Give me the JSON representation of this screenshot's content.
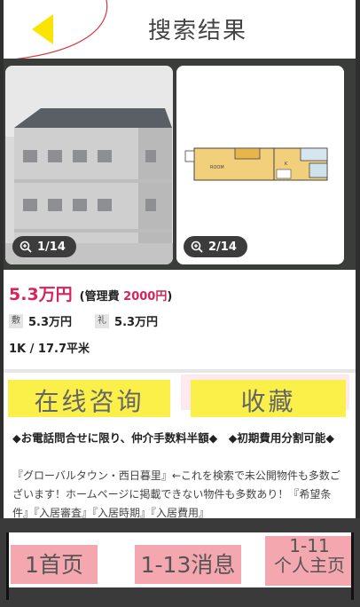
{
  "header": {
    "title": "搜索结果",
    "back_icon": "triangle-left-icon",
    "colors": {
      "back_icon": "#fbe400",
      "decoration": "#d9363e"
    }
  },
  "gallery": {
    "photos": [
      {
        "counter": "1/14",
        "icon": "zoom-in-icon",
        "kind": "building-exterior"
      },
      {
        "counter": "2/14",
        "icon": "zoom-in-icon",
        "kind": "floor-plan",
        "plan_labels": [
          "ROOM",
          "K"
        ]
      }
    ]
  },
  "listing": {
    "price": "5.3万円",
    "management_open": "(管理費",
    "management_fee": "2000円",
    "management_close": ")",
    "deposit_tag": "敷",
    "deposit": "5.3万円",
    "key_money_tag": "礼",
    "key_money": "5.3万円",
    "layout": "1K / 17.7平米",
    "colors": {
      "price": "#d6245b"
    }
  },
  "actions": {
    "consult_label": "在线咨询",
    "favorite_label": "收藏",
    "colors": {
      "button_bg": "#fbf04a"
    }
  },
  "description": {
    "highlight": "◆お電話問合せに限り、仲介手数料半額◆　◆初期費用分割可能◆",
    "body": "『グローバルタウン・西日暮里』←これを検索で未公開物件も多数ございます！ホームページに掲載できない物件も多数あり！『希望条件』『入居審査』『入居時期』『入居費用』"
  },
  "tabbar": {
    "home_label": "1首页",
    "messages_label": "1-13消息",
    "profile_line1": "1-11",
    "profile_line2": "个人主页",
    "colors": {
      "tab_bg": "#f4a7ae"
    }
  }
}
